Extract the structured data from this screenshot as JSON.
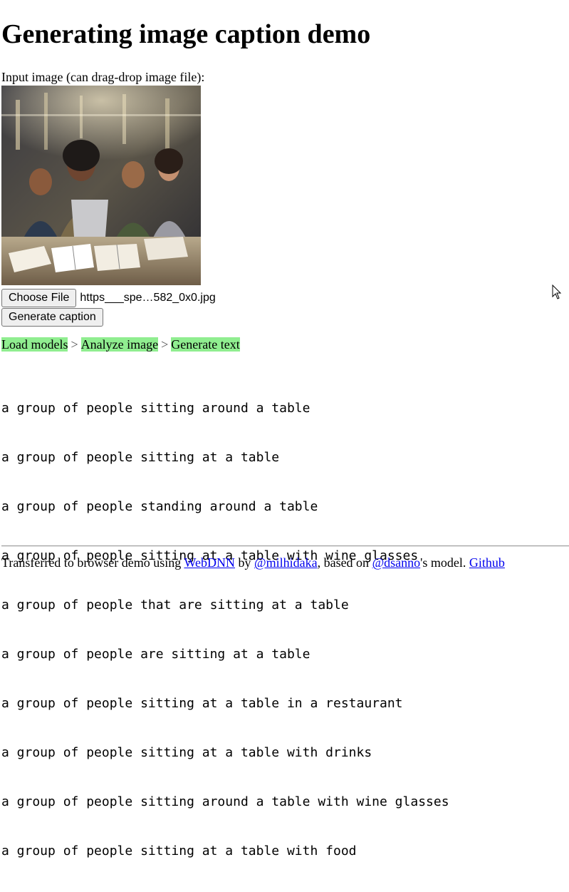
{
  "page": {
    "title": "Generating image caption demo"
  },
  "input": {
    "label": "Input image (can drag-drop image file):",
    "choose_file_label": "Choose File",
    "file_name": "https___spe…582_0x0.jpg",
    "generate_label": "Generate caption"
  },
  "steps": [
    {
      "label": "Load models"
    },
    {
      "label": "Analyze image"
    },
    {
      "label": "Generate text"
    }
  ],
  "step_separator": ">",
  "step_color": "#90ee90",
  "captions": [
    "a group of people sitting around a table",
    "a group of people sitting at a table",
    "a group of people standing around a table",
    "a group of people sitting at a table with wine glasses",
    "a group of people that are sitting at a table",
    "a group of people are sitting at a table",
    "a group of people sitting at a table in a restaurant",
    "a group of people sitting at a table with drinks",
    "a group of people sitting around a table with wine glasses",
    "a group of people sitting at a table with food"
  ],
  "footer": {
    "text_1": "Transferred to browser demo using ",
    "link_webdnn": "WebDNN",
    "text_2": " by ",
    "link_milhidaka": "@milhidaka",
    "text_3": ", based on ",
    "link_dsanno": "@dsanno",
    "text_4": "'s model. ",
    "link_github": "Github"
  },
  "link_color": "#0000ee"
}
